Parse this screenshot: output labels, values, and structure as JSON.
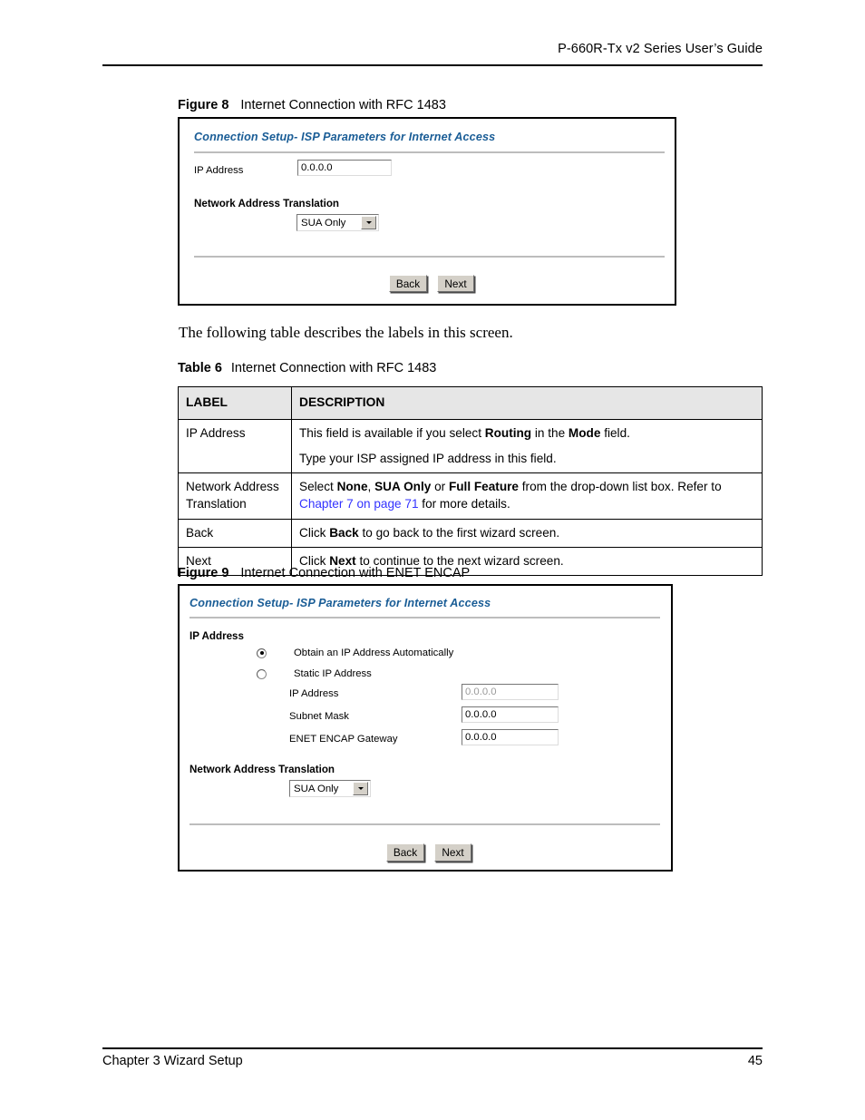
{
  "header": {
    "title": "P-660R-Tx v2 Series User’s Guide"
  },
  "footer": {
    "chapter": "Chapter 3 Wizard Setup",
    "page_number": "45"
  },
  "figure8": {
    "label": "Figure 8",
    "caption": "Internet Connection with RFC 1483",
    "screen": {
      "title": "Connection Setup- ISP Parameters for Internet Access",
      "ip_address_label": "IP Address",
      "ip_address_value": "0.0.0.0",
      "nat_heading": "Network Address Translation",
      "nat_selected": "SUA Only",
      "back_label": "Back",
      "next_label": "Next"
    }
  },
  "intro_paragraph": "The following table describes the labels in this screen.",
  "table6": {
    "label": "Table 6",
    "caption": "Internet Connection with RFC 1483",
    "columns": [
      "LABEL",
      "DESCRIPTION"
    ],
    "rows": [
      {
        "label": "IP Address",
        "paragraphs": [
          [
            {
              "t": "This field is available if you select ",
              "b": false
            },
            {
              "t": "Routing",
              "b": true
            },
            {
              "t": " in the ",
              "b": false
            },
            {
              "t": "Mode",
              "b": true
            },
            {
              "t": " field.",
              "b": false
            }
          ],
          [
            {
              "t": "Type your ISP assigned IP address in this field.",
              "b": false
            }
          ]
        ]
      },
      {
        "label": "Network Address Translation",
        "paragraphs": [
          [
            {
              "t": "Select ",
              "b": false
            },
            {
              "t": "None",
              "b": true
            },
            {
              "t": ", ",
              "b": false
            },
            {
              "t": "SUA Only",
              "b": true
            },
            {
              "t": " or ",
              "b": false
            },
            {
              "t": "Full Feature",
              "b": true
            },
            {
              "t": " from the drop-down list box. Refer to ",
              "b": false
            },
            {
              "t": "Chapter 7 on page 71",
              "b": false,
              "link": true
            },
            {
              "t": " for more details.",
              "b": false
            }
          ]
        ]
      },
      {
        "label": "Back",
        "paragraphs": [
          [
            {
              "t": "Click ",
              "b": false
            },
            {
              "t": "Back",
              "b": true
            },
            {
              "t": " to go back to the first wizard screen.",
              "b": false
            }
          ]
        ]
      },
      {
        "label": "Next",
        "paragraphs": [
          [
            {
              "t": "Click ",
              "b": false
            },
            {
              "t": "Next",
              "b": true
            },
            {
              "t": " to continue to the next wizard screen.",
              "b": false
            }
          ]
        ]
      }
    ],
    "link_color": "#3333ff",
    "header_bg": "#e6e6e6"
  },
  "figure9": {
    "label": "Figure 9",
    "caption": "Internet Connection with ENET ENCAP",
    "screen": {
      "title": "Connection Setup- ISP Parameters for Internet Access",
      "ip_section_heading": "IP Address",
      "radio_auto_label": "Obtain an IP Address Automatically",
      "radio_static_label": "Static IP Address",
      "fields": [
        {
          "label": "IP Address",
          "value": "0.0.0.0",
          "disabled": true
        },
        {
          "label": "Subnet Mask",
          "value": "0.0.0.0",
          "disabled": false
        },
        {
          "label": "ENET ENCAP Gateway",
          "value": "0.0.0.0",
          "disabled": false
        }
      ],
      "nat_heading": "Network Address Translation",
      "nat_selected": "SUA Only",
      "back_label": "Back",
      "next_label": "Next"
    }
  },
  "theme": {
    "screen_title_color": "#1a5d96",
    "button_face": "#d4d0c8"
  }
}
